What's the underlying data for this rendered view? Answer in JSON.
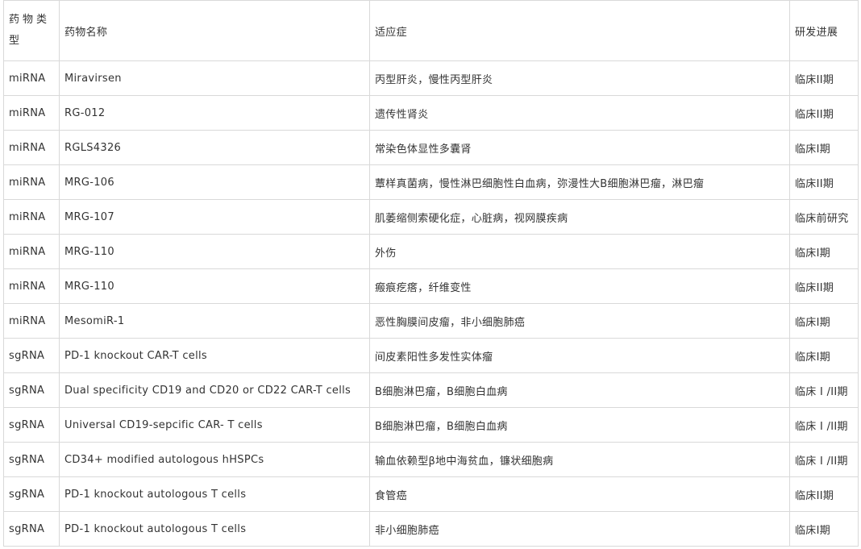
{
  "headers": {
    "type": "药物类型",
    "name": "药物名称",
    "indication": "适应症",
    "progress": "研发进展"
  },
  "rows": [
    {
      "type": "miRNA",
      "name": "Miravirsen",
      "indication": "丙型肝炎，慢性丙型肝炎",
      "progress": "临床II期"
    },
    {
      "type": "miRNA",
      "name": "RG-012",
      "indication": "遗传性肾炎",
      "progress": "临床II期"
    },
    {
      "type": "miRNA",
      "name": "RGLS4326",
      "indication": "常染色体显性多囊肾",
      "progress": "临床I期"
    },
    {
      "type": "miRNA",
      "name": "MRG-106",
      "indication": "蕈样真菌病，慢性淋巴细胞性白血病，弥漫性大B细胞淋巴瘤，淋巴瘤",
      "progress": "临床II期"
    },
    {
      "type": "miRNA",
      "name": "MRG-107",
      "indication": "肌萎缩侧索硬化症，心脏病，视网膜疾病",
      "progress": "临床前研究"
    },
    {
      "type": "miRNA",
      "name": "MRG-110",
      "indication": "外伤",
      "progress": "临床I期"
    },
    {
      "type": "miRNA",
      "name": "MRG-110",
      "indication": "瘢痕疙瘩，纤维变性",
      "progress": "临床II期"
    },
    {
      "type": "miRNA",
      "name": "MesomiR-1",
      "indication": "恶性胸膜间皮瘤，非小细胞肺癌",
      "progress": "临床I期"
    },
    {
      "type": "sgRNA",
      "name": "PD-1 knockout CAR-T cells",
      "indication": "间皮素阳性多发性实体瘤",
      "progress": "临床I期"
    },
    {
      "type": "sgRNA",
      "name": "Dual specificity CD19 and CD20 or CD22 CAR-T cells",
      "indication": "B细胞淋巴瘤，B细胞白血病",
      "progress": "临床 I /II期"
    },
    {
      "type": "sgRNA",
      "name": "Universal CD19-sepcific CAR- T cells",
      "indication": "B细胞淋巴瘤，B细胞白血病",
      "progress": "临床 I /II期"
    },
    {
      "type": "sgRNA",
      "name": "CD34+ modified autologous hHSPCs",
      "indication": "输血依赖型β地中海贫血，镰状细胞病",
      "progress": "临床 I /II期"
    },
    {
      "type": "sgRNA",
      "name": "PD-1 knockout autologous T cells",
      "indication": "食管癌",
      "progress": "临床II期"
    },
    {
      "type": "sgRNA",
      "name": "PD-1 knockout autologous T cells",
      "indication": "非小细胞肺癌",
      "progress": "临床I期"
    }
  ]
}
